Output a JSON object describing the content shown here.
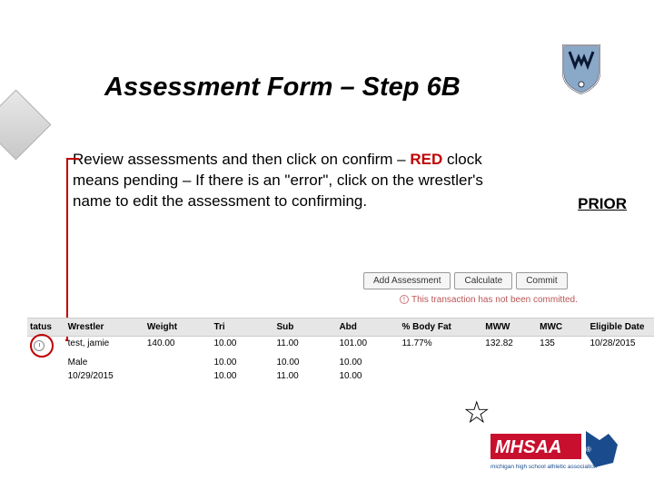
{
  "title": "Assessment Form – Step 6B",
  "body": {
    "line1": "Review assessments and then click on confirm –",
    "red_word": "RED",
    "line2_rest": " clock means pending – If there is an \"error\", click on the wrestler's name to edit the assessment to confirming."
  },
  "prior_label": "PRIOR",
  "buttons": {
    "add": "Add Assessment",
    "calculate": "Calculate",
    "commit": "Commit"
  },
  "commit_warning": "This transaction has not been committed.",
  "table": {
    "headers": {
      "status": "tatus",
      "wrestler": "Wrestler",
      "weight": "Weight",
      "tri": "Tri",
      "sub": "Sub",
      "abd": "Abd",
      "bodyfat": "% Body Fat",
      "mww": "MWW",
      "mwc": "MWC",
      "eligible": "Eligible Date"
    },
    "row1": {
      "wrestler": "test, jamie",
      "weight": "140.00",
      "tri": "10.00",
      "sub": "11.00",
      "abd": "101.00",
      "bodyfat": "11.77%",
      "mww": "132.82",
      "mwc": "135",
      "eligible": "10/28/2015"
    },
    "row2": {
      "wrestler": "Male",
      "tri": "10.00",
      "sub": "10.00",
      "abd": "10.00"
    },
    "row3": {
      "wrestler": "10/29/2015",
      "tri": "10.00",
      "sub": "11.00",
      "abd": "10.00"
    }
  },
  "mhsaa_tagline": "michigan high school athletic association"
}
